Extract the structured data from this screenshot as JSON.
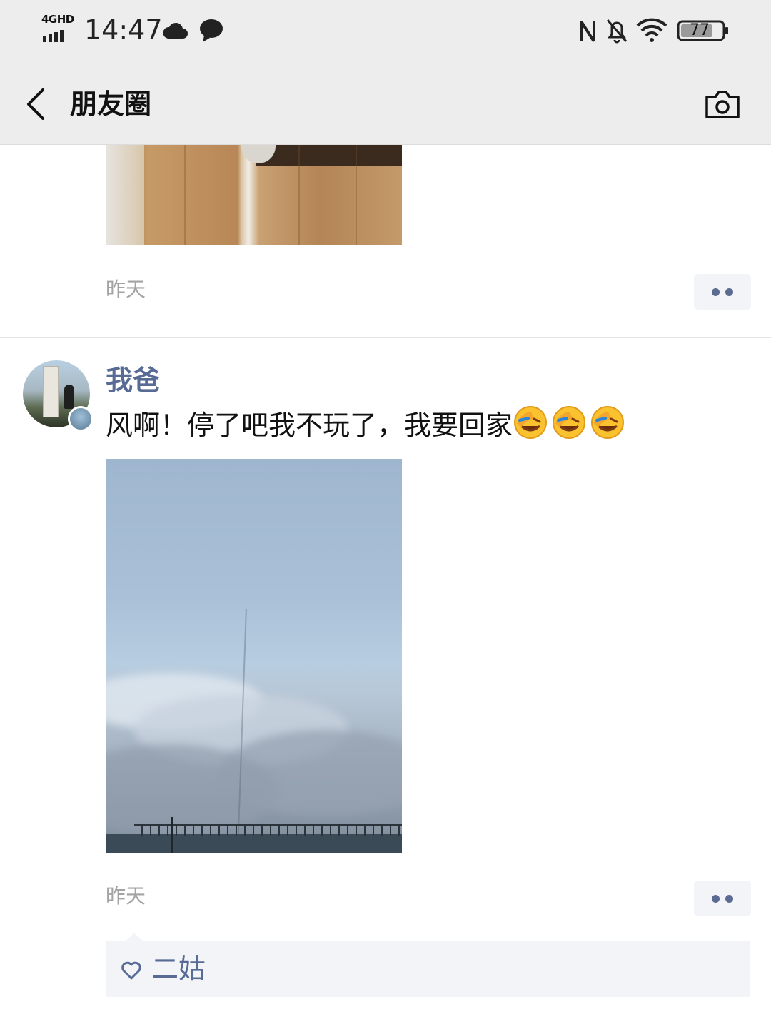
{
  "status_bar": {
    "network": "4GHD",
    "time": "14:47",
    "battery": "77",
    "icons": [
      "cloud-icon",
      "chat-bubble-icon",
      "nfc-icon",
      "mute-bell-icon",
      "wifi-icon",
      "battery-icon"
    ]
  },
  "nav": {
    "title": "朋友圈",
    "back_icon": "chevron-left-icon",
    "camera_icon": "camera-icon"
  },
  "posts": [
    {
      "time": "昨天",
      "more_icon": "more-dots-icon"
    },
    {
      "author": "我爸",
      "text": "风啊！停了吧我不玩了，我要回家",
      "emojis": [
        "facepalm-laugh-emoji",
        "facepalm-laugh-emoji",
        "facepalm-laugh-emoji"
      ],
      "time": "昨天",
      "more_icon": "more-dots-icon",
      "likes": {
        "icon": "heart-icon",
        "names": "二姑"
      }
    }
  ],
  "colors": {
    "bar_background": "#ededed",
    "link_blue": "#576b95",
    "meta_gray": "#a3a3a3",
    "likes_background": "#f3f4f7"
  }
}
